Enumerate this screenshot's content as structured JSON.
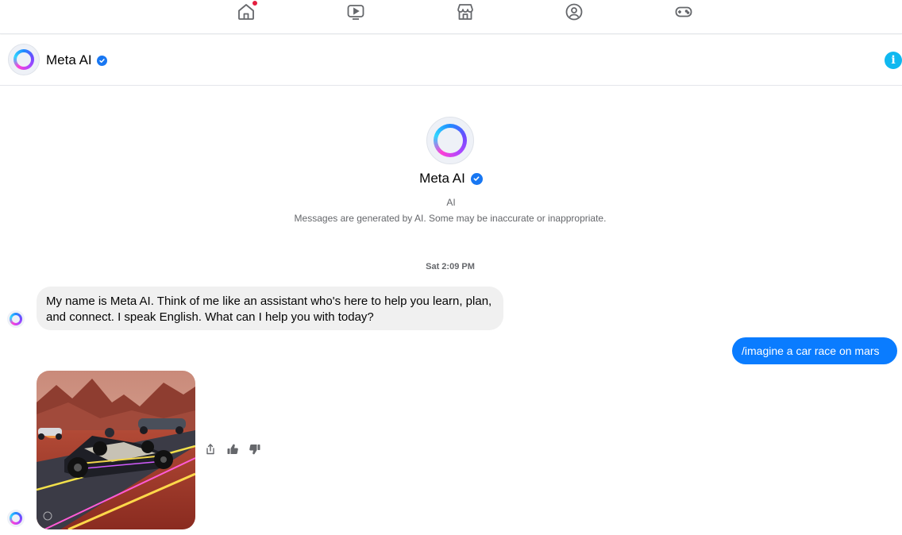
{
  "topnav": {
    "items": [
      {
        "icon": "home-icon",
        "has_notification": true
      },
      {
        "icon": "video-icon"
      },
      {
        "icon": "marketplace-icon"
      },
      {
        "icon": "groups-icon"
      },
      {
        "icon": "gaming-icon"
      }
    ],
    "notification_color": "#e41e3f"
  },
  "header": {
    "title": "Meta AI",
    "verified": true,
    "info_icon": "info-icon"
  },
  "profile": {
    "name": "Meta AI",
    "subtitle": "AI",
    "disclaimer": "Messages are generated by AI. Some may be inaccurate or inappropriate."
  },
  "conversation": {
    "timestamp": "Sat 2:09 PM",
    "messages": [
      {
        "from": "Meta AI",
        "text": "My name is Meta AI. Think of me like an assistant who's here to help you learn, plan, and connect. I speak English. What can I help you with today?"
      },
      {
        "from": "user",
        "text": "/imagine a car race on mars"
      },
      {
        "from": "Meta AI",
        "type": "image",
        "image_description": "race-car-on-mars-image"
      }
    ],
    "image_actions": [
      "share-icon",
      "thumbs-up-icon",
      "thumbs-down-icon"
    ]
  },
  "colors": {
    "accent": "#0a7cff",
    "verified": "#1877f2",
    "info": "#0fb8f0",
    "incoming_bubble": "#f0f0f0"
  }
}
